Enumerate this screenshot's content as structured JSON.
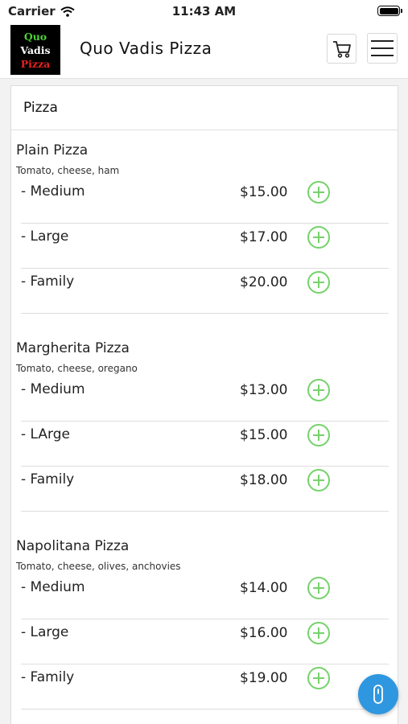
{
  "status_bar": {
    "carrier": "Carrier",
    "time": "11:43 AM"
  },
  "header": {
    "logo_lines": [
      "Quo",
      "Vadis",
      "Pizza"
    ],
    "title": "Quo Vadis Pizza"
  },
  "section": {
    "title": "Pizza"
  },
  "groups": [
    {
      "name": "Plain Pizza",
      "description": "Tomato, cheese, ham",
      "items": [
        {
          "name": "- Medium",
          "price": "$15.00"
        },
        {
          "name": "- Large",
          "price": "$17.00"
        },
        {
          "name": "- Family",
          "price": "$20.00"
        }
      ]
    },
    {
      "name": "Margherita Pizza",
      "description": "Tomato, cheese, oregano",
      "items": [
        {
          "name": "- Medium",
          "price": "$13.00"
        },
        {
          "name": "- LArge",
          "price": "$15.00"
        },
        {
          "name": "- Family",
          "price": "$18.00"
        }
      ]
    },
    {
      "name": "Napolitana Pizza",
      "description": "Tomato, cheese, olives, anchovies",
      "items": [
        {
          "name": "- Medium",
          "price": "$14.00"
        },
        {
          "name": "- Large",
          "price": "$16.00"
        },
        {
          "name": "- Family",
          "price": "$19.00"
        }
      ]
    }
  ],
  "icons": {
    "cart": "cart-icon",
    "menu": "hamburger-menu-icon",
    "add": "plus-circle-icon",
    "fab": "chat-icon",
    "wifi": "wifi-icon",
    "battery": "battery-icon"
  },
  "colors": {
    "add_green": "#75d26b",
    "fab_blue": "#2f97e0"
  }
}
